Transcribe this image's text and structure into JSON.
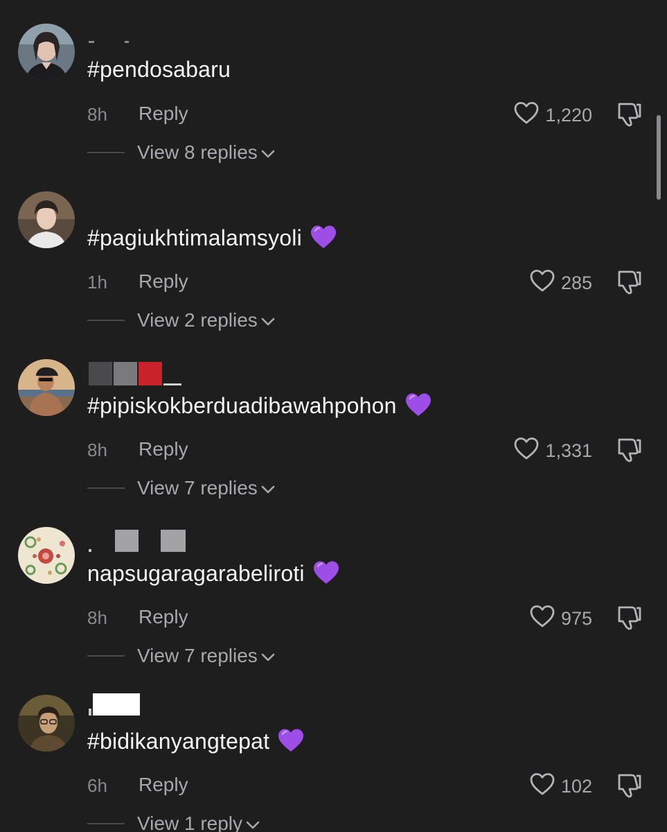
{
  "comments": [
    {
      "text": "#pendosabaru",
      "emoji": false,
      "time": "8h",
      "reply": "Reply",
      "likes": "1,220",
      "view_replies": "View 8 replies"
    },
    {
      "text": "#pagiukhtimalamsyoli",
      "emoji": true,
      "time": "1h",
      "reply": "Reply",
      "likes": "285",
      "view_replies": "View 2 replies"
    },
    {
      "text": "#pipiskokberduadibawahpohon",
      "emoji": true,
      "time": "8h",
      "reply": "Reply",
      "likes": "1,331",
      "view_replies": "View 7 replies"
    },
    {
      "text": "napsugaragarabeliroti",
      "emoji": true,
      "time": "8h",
      "reply": "Reply",
      "likes": "975",
      "view_replies": "View 7 replies"
    },
    {
      "text": "#bidikanyangtepat ",
      "emoji": true,
      "time": "6h",
      "reply": "Reply",
      "likes": "102",
      "view_replies": "View 1 reply"
    }
  ],
  "colors": {
    "background": "#1e1e1f",
    "text": "#f5f5f5",
    "muted": "#a9a9ab",
    "emoji_heart": "#9d4ee6"
  },
  "icons": {
    "like": "heart-outline-icon",
    "dislike": "thumbs-down-icon",
    "expand": "chevron-down-icon",
    "emoji": "purple-heart-emoji"
  }
}
